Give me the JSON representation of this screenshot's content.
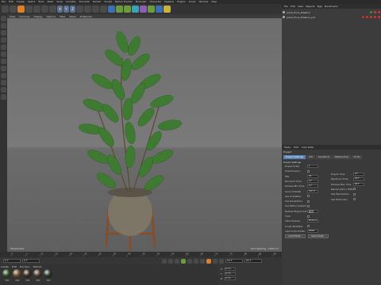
{
  "menubar": {
    "items": [
      "File",
      "Edit",
      "Create",
      "Select",
      "Tools",
      "Mesh",
      "Snap",
      "Animate",
      "Simulate",
      "Render",
      "Sculpt",
      "Motion Tracker",
      "MoGraph",
      "Character",
      "Pipeline",
      "Plugins",
      "Script",
      "Window",
      "Help"
    ]
  },
  "viewport": {
    "menu": [
      "View",
      "Cameras",
      "Display",
      "Options",
      "Filter",
      "Panel",
      "ProRender"
    ],
    "label_left": "Perspective",
    "label_right": "Grid Spacing : 1000 cm"
  },
  "timeline": {
    "ticks": [
      "0",
      "5",
      "10",
      "15",
      "20",
      "25",
      "30",
      "35",
      "40",
      "45",
      "50",
      "55",
      "60",
      "65",
      "70",
      "75",
      "80",
      "85",
      "90"
    ],
    "start_field": "0 F",
    "current_field": "0 F",
    "end_field": "90 F",
    "end_field2": "90 F"
  },
  "materials": {
    "menu": [
      "Create",
      "Edit",
      "Function",
      "Texture"
    ],
    "items": [
      {
        "label": "Mat",
        "color": "#2d4a1f"
      },
      {
        "label": "Mat",
        "color": "#6b4a2a"
      },
      {
        "label": "Mat",
        "color": "#3a2a1f"
      },
      {
        "label": "Mat",
        "color": "#4a3a2d"
      },
      {
        "label": "Mat",
        "color": "#2a3a2a"
      }
    ]
  },
  "coords": {
    "rows": [
      {
        "axis": "X",
        "value": "0 cm"
      },
      {
        "axis": "Y",
        "value": "0 cm"
      },
      {
        "axis": "Z",
        "value": "0 cm"
      }
    ]
  },
  "object_manager": {
    "menu": [
      "File",
      "Edit",
      "View",
      "Objects",
      "Tags",
      "Bookmarks"
    ],
    "rows": [
      {
        "name": "plant_Ficus_Elastica",
        "tags": [
          "#3a8a3a",
          "#c33",
          "#c33"
        ]
      },
      {
        "name": "plant_Ficus_Elastica_pot",
        "tags": [
          "#a33",
          "#c33",
          "#c33",
          "#c33",
          "#c33"
        ]
      }
    ]
  },
  "attributes": {
    "menu": [
      "Mode",
      "Edit",
      "User Data"
    ],
    "title": "Project",
    "tabs": [
      "Project Settings",
      "Info",
      "Dynamics",
      "Referencing",
      "To Do"
    ],
    "active_tab": 0,
    "section": "Project Settings",
    "left_fields": [
      {
        "label": "Project Scale",
        "value": "1"
      },
      {
        "label": "Scale Project...",
        "value": ""
      },
      {
        "label": "FPS",
        "value": "30"
      },
      {
        "label": "Minimum Time",
        "value": "0 F"
      },
      {
        "label": "Preview Min Time",
        "value": "0 F"
      },
      {
        "label": "Level of Detail",
        "value": "100 %"
      },
      {
        "label": "Use Animation",
        "value": ""
      },
      {
        "label": "Use Generators",
        "value": ""
      },
      {
        "label": "Use Motion System",
        "value": ""
      },
      {
        "label": "Default Object Color",
        "value": "Gray-Blue"
      },
      {
        "label": "Color",
        "value": ""
      },
      {
        "label": "View Clipping",
        "value": "Medium"
      },
      {
        "label": "Linear Workflow",
        "value": ""
      },
      {
        "label": "Input Color Profile",
        "value": "sRGB"
      }
    ],
    "right_fields": [
      {
        "label": "Project Time",
        "value": "0 F"
      },
      {
        "label": "Maximum Time",
        "value": "90 F"
      },
      {
        "label": "Preview Max Time",
        "value": "90 F"
      },
      {
        "label": "Render LOD in Editor",
        "value": ""
      },
      {
        "label": "Use Expressions",
        "value": ""
      },
      {
        "label": "Use Deformers",
        "value": ""
      }
    ],
    "buttons": [
      "Load Preset...",
      "Save Preset..."
    ]
  }
}
